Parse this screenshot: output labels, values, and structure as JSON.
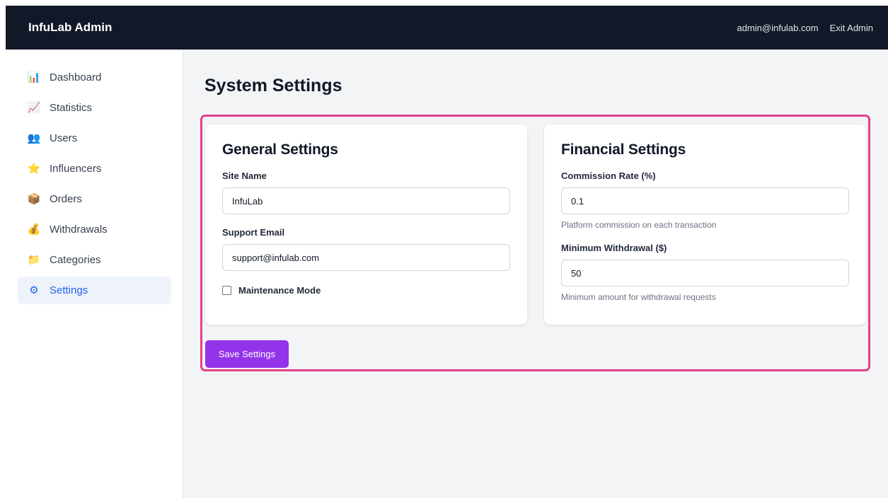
{
  "header": {
    "brand": "InfuLab Admin",
    "user_email": "admin@infulab.com",
    "exit_label": "Exit Admin"
  },
  "sidebar": {
    "items": [
      {
        "label": "Dashboard",
        "icon": "bar-chart-icon",
        "glyph": "📊",
        "active": false
      },
      {
        "label": "Statistics",
        "icon": "line-chart-icon",
        "glyph": "📈",
        "active": false
      },
      {
        "label": "Users",
        "icon": "users-icon",
        "glyph": "👥",
        "active": false
      },
      {
        "label": "Influencers",
        "icon": "star-icon",
        "glyph": "⭐",
        "active": false
      },
      {
        "label": "Orders",
        "icon": "package-icon",
        "glyph": "📦",
        "active": false
      },
      {
        "label": "Withdrawals",
        "icon": "money-bag-icon",
        "glyph": "💰",
        "active": false
      },
      {
        "label": "Categories",
        "icon": "folder-icon",
        "glyph": "📁",
        "active": false
      },
      {
        "label": "Settings",
        "icon": "gear-icon",
        "glyph": "⚙",
        "active": true
      }
    ]
  },
  "page": {
    "title": "System Settings",
    "general": {
      "title": "General Settings",
      "site_name_label": "Site Name",
      "site_name_value": "InfuLab",
      "support_email_label": "Support Email",
      "support_email_value": "support@infulab.com",
      "maintenance_label": "Maintenance Mode",
      "maintenance_checked": false
    },
    "financial": {
      "title": "Financial Settings",
      "commission_label": "Commission Rate (%)",
      "commission_value": "0.1",
      "commission_hint": "Platform commission on each transaction",
      "min_withdrawal_label": "Minimum Withdrawal ($)",
      "min_withdrawal_value": "50",
      "min_withdrawal_hint": "Minimum amount for withdrawal requests"
    },
    "save_label": "Save Settings"
  },
  "colors": {
    "topbar": "#111827",
    "accent_purple": "#9333ea",
    "highlight_pink": "#e2418d",
    "active_nav_text": "#2563eb",
    "active_nav_bg": "#eef2fb"
  }
}
